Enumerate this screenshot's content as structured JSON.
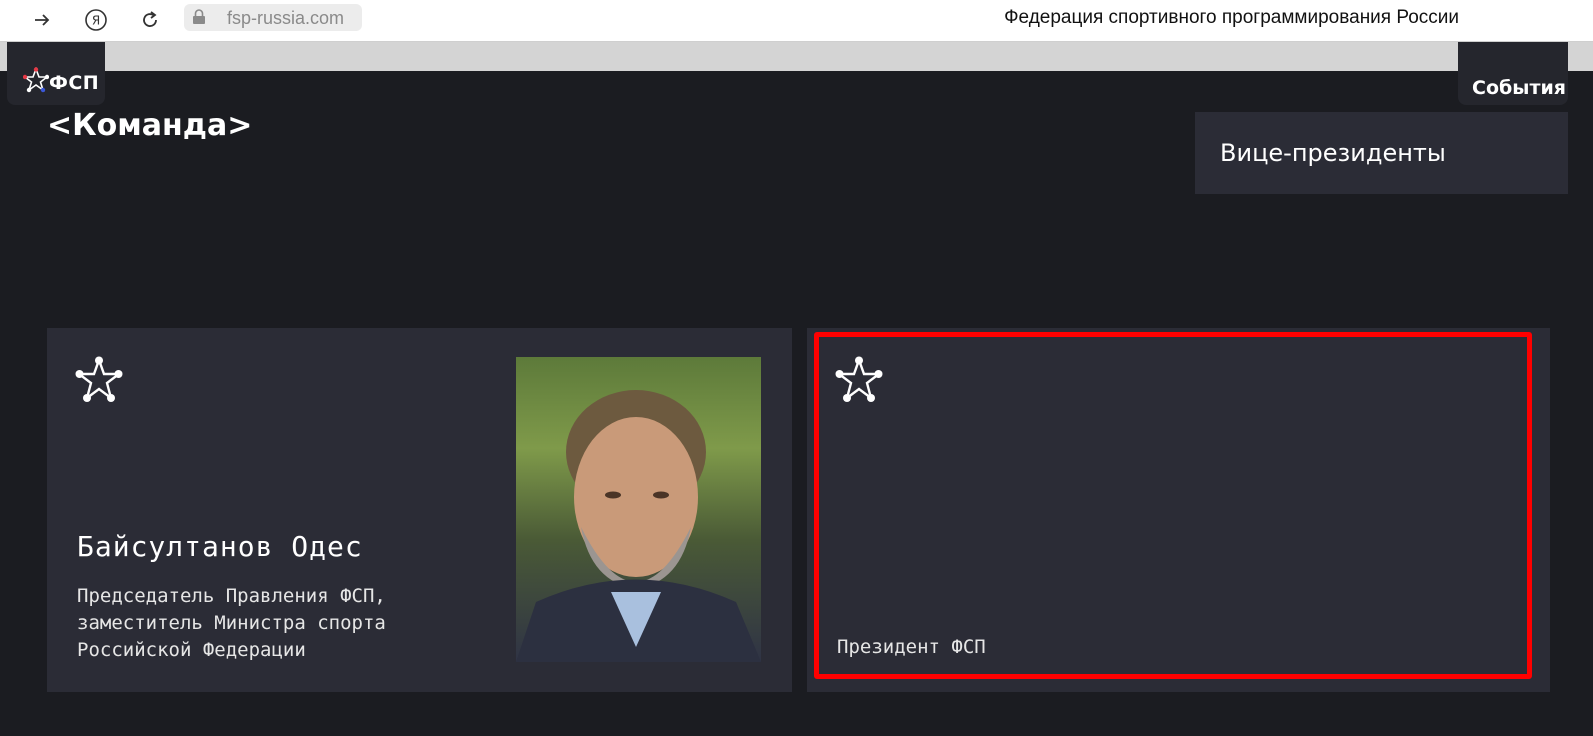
{
  "browser": {
    "url": "fsp-russia.com",
    "page_title": "Федерация спортивного программирования России",
    "icons": [
      "forward-icon",
      "yandex-icon",
      "reload-icon",
      "lock-icon"
    ]
  },
  "header": {
    "logo_text": "ФСП",
    "events_label": "События"
  },
  "section": {
    "title": "<Команда>",
    "vice_presidents_label": "Вице-президенты"
  },
  "cards": [
    {
      "name": "Байсултанов Одес",
      "role": "Председатель Правления ФСП, заместитель Министра спорта Российской Федерации"
    },
    {
      "name": "",
      "role": "Президент ФСП"
    }
  ],
  "colors": {
    "background": "#1b1c21",
    "card": "#2b2c36",
    "highlight": "#ff0000",
    "logo_red": "#e63946",
    "logo_blue": "#3a57d8"
  }
}
